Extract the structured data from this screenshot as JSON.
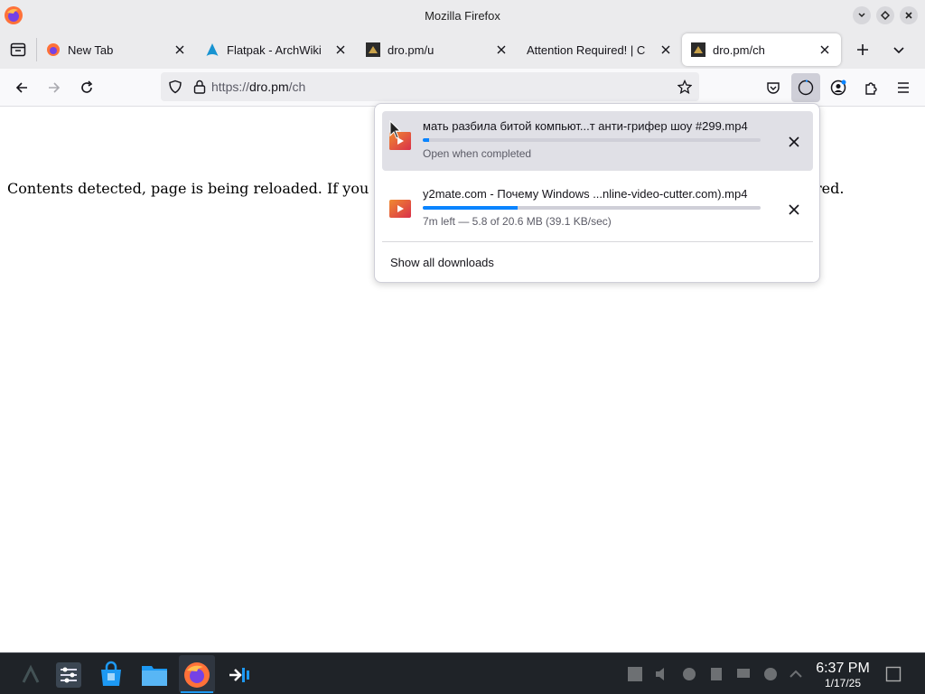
{
  "window": {
    "title": "Mozilla Firefox"
  },
  "tabs": [
    {
      "label": "New Tab",
      "icon": "firefox-icon"
    },
    {
      "label": "Flatpak - ArchWiki",
      "icon": "archlinux-icon"
    },
    {
      "label": "dro.pm/u",
      "icon": "dro-pm-icon"
    },
    {
      "label": "Attention Required! | C",
      "icon": "none"
    },
    {
      "label": "dro.pm/ch",
      "icon": "dro-pm-icon",
      "active": true
    }
  ],
  "url": {
    "scheme": "https://",
    "host": "dro.pm",
    "path": "/ch"
  },
  "page": {
    "text": "Contents detected, page is being reloaded. If you st",
    "text_tail": "red."
  },
  "downloads": {
    "items": [
      {
        "name": "мать разбила битой компьют...т анти-грифер шоу #299.mp4",
        "status": "Open when completed",
        "progress": 0.02
      },
      {
        "name": "y2mate.com - Почему Windows ...nline-video-cutter.com).mp4",
        "status": "7m left — 5.8 of 20.6 MB (39.1 KB/sec)",
        "progress": 0.28
      }
    ],
    "show_all": "Show all downloads"
  },
  "clock": {
    "time": "6:37 PM",
    "date": "1/17/25"
  },
  "colors": {
    "accent": "#0a84ff",
    "titlebar": "#ebebed",
    "taskbar": "#1f2328"
  }
}
